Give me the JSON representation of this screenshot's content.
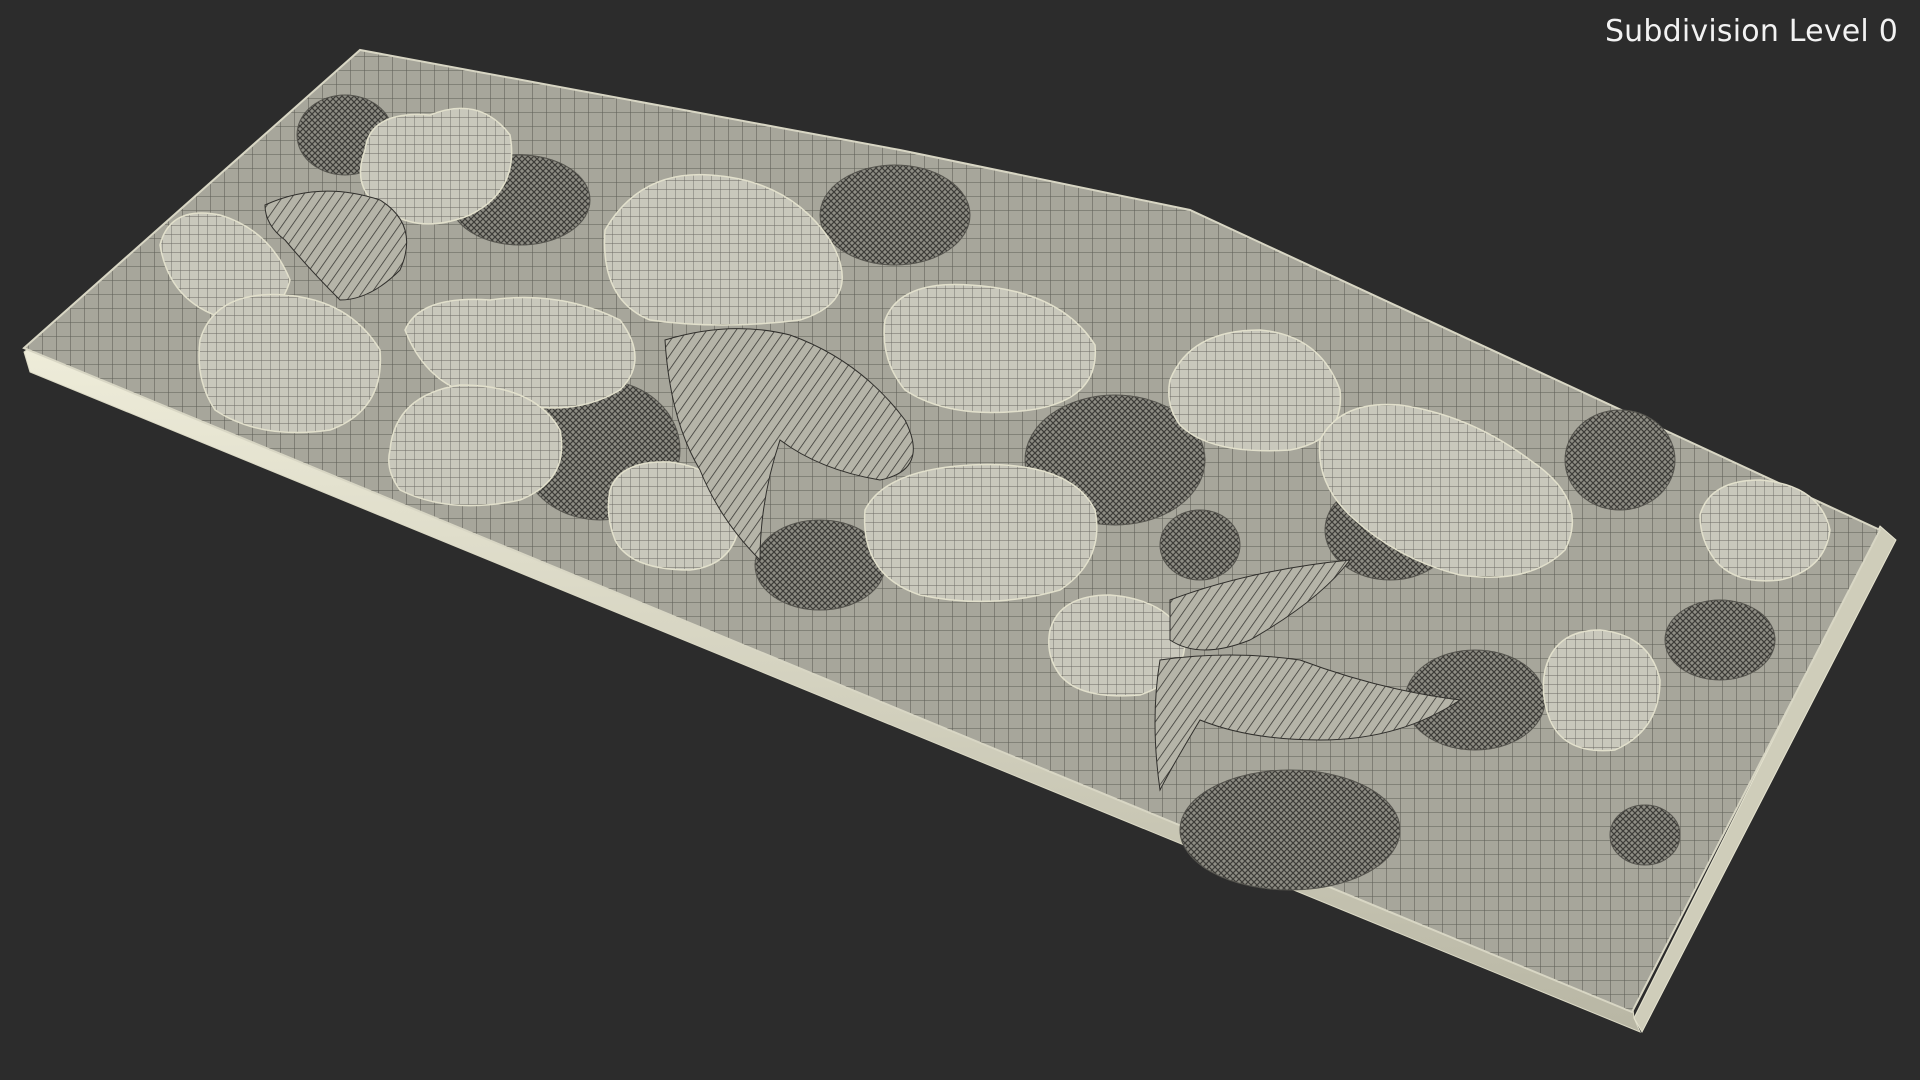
{
  "overlay": {
    "subdivision_label": "Subdivision Level 0"
  },
  "scene": {
    "subject": "moss-wall-wireframe-model",
    "background_color": "#2c2c2c",
    "mesh_color": "#a9a89d",
    "edge_color": "#e9e7d5"
  }
}
